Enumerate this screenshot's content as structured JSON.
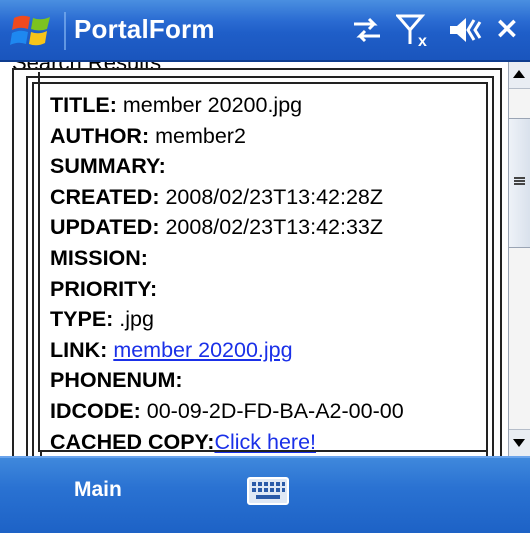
{
  "titlebar": {
    "app_title": "PortalForm",
    "close_label": "×",
    "icons": [
      "windows-start-icon",
      "connectivity-icon",
      "signal-off-icon",
      "volume-icon"
    ]
  },
  "content": {
    "section_title": "Search Results",
    "fields": [
      {
        "label": "TITLE:",
        "value": " member 20200.jpg"
      },
      {
        "label": "AUTHOR:",
        "value": " member2"
      },
      {
        "label": "SUMMARY:",
        "value": ""
      },
      {
        "label": "CREATED:",
        "value": " 2008/02/23T13:42:28Z"
      },
      {
        "label": "UPDATED:",
        "value": " 2008/02/23T13:42:33Z"
      },
      {
        "label": "MISSION:",
        "value": ""
      },
      {
        "label": "PRIORITY:",
        "value": ""
      },
      {
        "label": "TYPE:",
        "value": " .jpg"
      },
      {
        "label": "LINK:",
        "value": " ",
        "link": "member 20200.jpg"
      },
      {
        "label": "PHONENUM:",
        "value": ""
      },
      {
        "label": "IDCODE:",
        "value": " 00-09-2D-FD-BA-A2-00-00"
      },
      {
        "label": "CACHED COPY:",
        "value": "",
        "link": "Click here!"
      }
    ]
  },
  "softkeys": {
    "left_label": "Main",
    "center_icon": "keyboard-icon"
  },
  "colors": {
    "titlebar": "#1f5ec8",
    "softbar": "#2a72d2",
    "link": "#1a30e8"
  }
}
